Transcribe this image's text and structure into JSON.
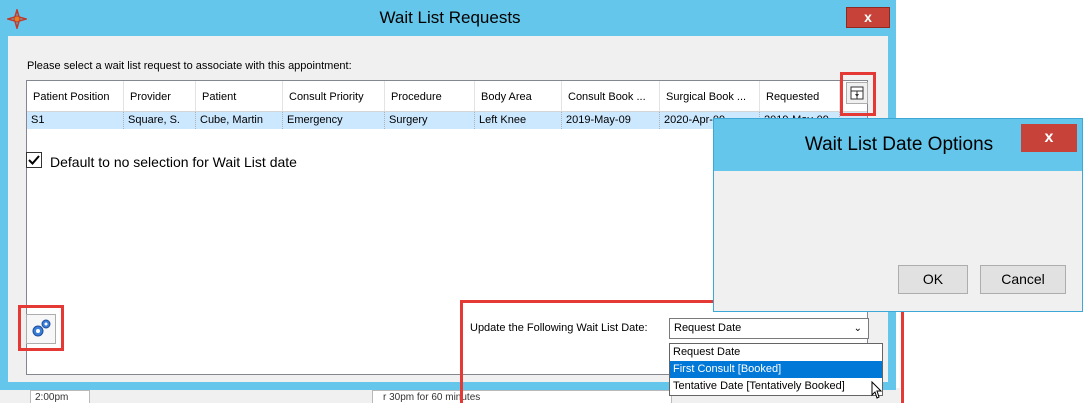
{
  "background": {
    "time_text": "2:00pm",
    "duration_text": "r 30pm for 60 minutes"
  },
  "window": {
    "title": "Wait List Requests",
    "close_label": "x",
    "prompt": "Please select a wait list request to associate with this appointment:"
  },
  "table": {
    "headers": [
      "Patient Position",
      "Provider",
      "Patient",
      "Consult Priority",
      "Procedure",
      "Body Area",
      "Consult Book ...",
      "Surgical Book ...",
      "Requested"
    ],
    "rows": [
      [
        "S1",
        "Square, S.",
        "Cube, Martin",
        "Emergency",
        "Surgery",
        "Left Knee",
        "2019-May-09",
        "2020-Apr-09",
        "2019-May-09"
      ]
    ]
  },
  "update": {
    "label": "Update the Following Wait List Date:",
    "selected": "Request Date",
    "options": [
      "Request Date",
      "First Consult [Booked]",
      "Tentative Date [Tentatively Booked]"
    ],
    "highlighted_index": 1
  },
  "dialog": {
    "title": "Wait List Date Options",
    "close_label": "x",
    "checkbox_label": "Default to no selection for Wait List date",
    "checkbox_checked": true,
    "ok_label": "OK",
    "cancel_label": "Cancel"
  },
  "colors": {
    "title_bar": "#64c6ea",
    "highlight_box": "#e53935",
    "selected_row": "#cce8ff",
    "selected_option": "#0078d7",
    "close_button": "#c7433a"
  }
}
